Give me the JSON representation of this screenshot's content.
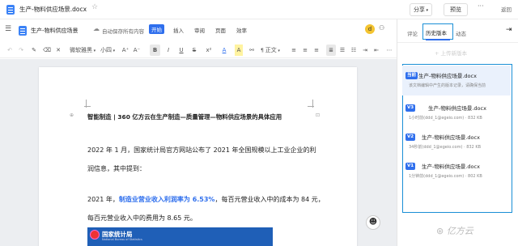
{
  "titlebar": {
    "filename": "生产-物料供应场景.docx",
    "share_label": "分享",
    "preview_label": "预览",
    "more_label": "···",
    "back_label": "返回"
  },
  "toolbar1": {
    "doc_title": "生产-物料供应场景",
    "autosave": "自动保存所有内容",
    "menus": [
      "开始",
      "插入",
      "审阅",
      "页面",
      "效率"
    ],
    "avatar_letter": "d"
  },
  "toolbar2": {
    "font_name": "微软雅黑",
    "font_size": "小四",
    "bold": "B",
    "italic": "I",
    "underline": "U",
    "strike": "S",
    "font_color": "A",
    "highlight": "A",
    "body_text": "正文"
  },
  "document": {
    "heading": "智能制造 | 360 亿方云在生产制造—质量管理—物料供应场景的具体应用",
    "para1_line1": "2022 年 1 月，国家统计局官方网站公布了 2021 年全国规模以上工业企业的利",
    "para1_line2": "润信息，其中提到：",
    "para2_prefix": "2021 年，",
    "para2_highlight": "制造业营业收入利润率为 6.53%",
    "para2_suffix": "，每百元营业收入中的成本为 84 元，",
    "para2_line2": "每百元营业收入中的费用为 8.65 元。",
    "banner_title": "国家统计局",
    "banner_sub": "National Bureau of Statistics"
  },
  "rightpanel": {
    "tabs": [
      "评论",
      "历史版本",
      "动态"
    ],
    "upload_label": "上传新版本",
    "versions": [
      {
        "badge": "当前",
        "name": "生产-物料供应场景.docx",
        "meta": "该文档编辑中产生的版本记录，请确保当前"
      },
      {
        "badge": "V3",
        "name": "生产-物料供应场景.docx",
        "meta": "1小时前(ddd_1@egeio.com) · 832 KB"
      },
      {
        "badge": "V2",
        "name": "生产-物料供应场景.docx",
        "meta": "34秒前(ddd_1@egeio.com) · 832 KB"
      },
      {
        "badge": "V1",
        "name": "生产-物料供应场景.docx",
        "meta": "1分钟前(ddd_1@egeio.com) · 802 KB"
      }
    ]
  },
  "watermark": "亿方云",
  "colors": {
    "accent": "#2f6fed",
    "highlight_box": "#1a8fd6"
  }
}
